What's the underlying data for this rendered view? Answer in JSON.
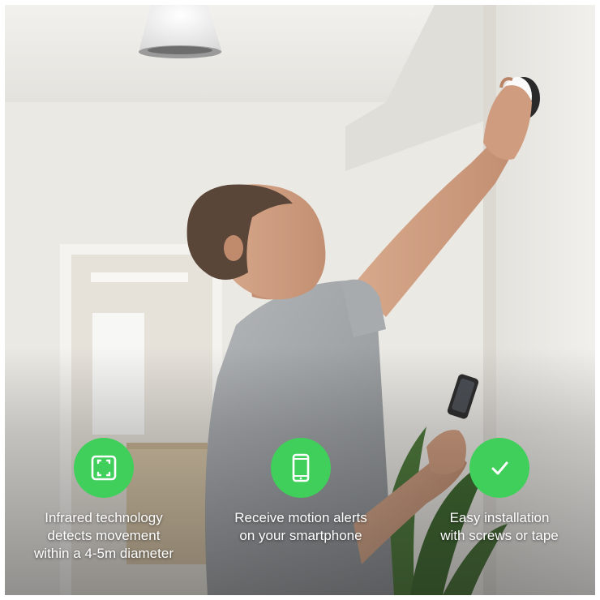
{
  "theme": {
    "accent": "#3fcf5a",
    "caption_color": "#ffffff"
  },
  "features": [
    {
      "icon": "scan-frame-icon",
      "lines": [
        "Infrared technology",
        "detects movement",
        "within a 4-5m diameter"
      ]
    },
    {
      "icon": "smartphone-icon",
      "lines": [
        "Receive motion alerts",
        "on your smartphone"
      ]
    },
    {
      "icon": "checkmark-icon",
      "lines": [
        "Easy installation",
        "with screws or tape"
      ]
    }
  ]
}
